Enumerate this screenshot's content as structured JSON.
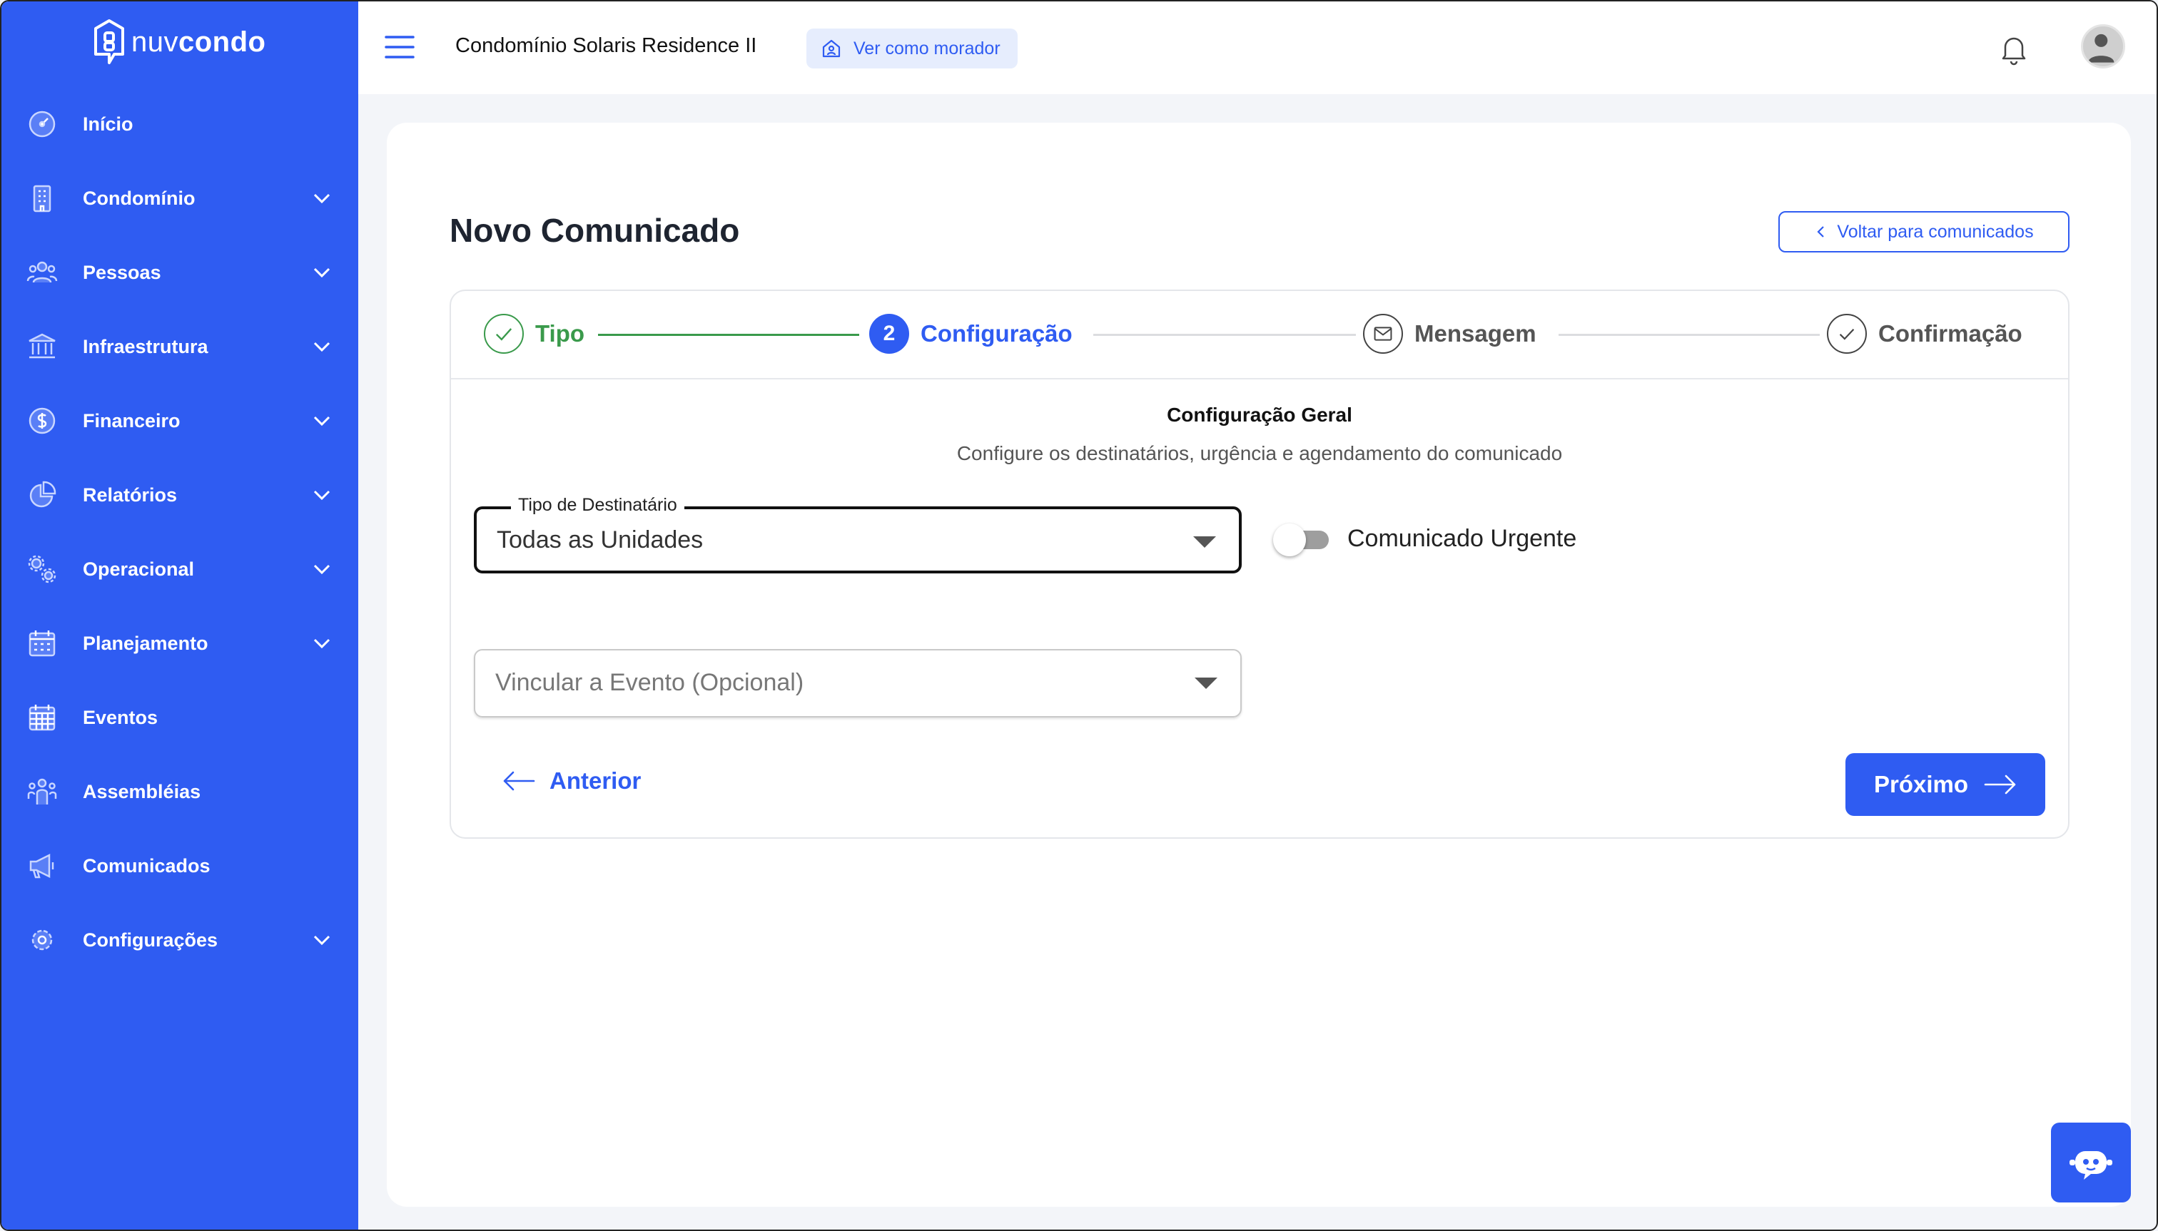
{
  "brand": {
    "name_light": "nuv",
    "name_bold": "condo",
    "accent": "#2f5cf2",
    "success": "#3a9a4b"
  },
  "sidebar": {
    "items": [
      {
        "label": "Início",
        "icon": "dashboard-icon",
        "expandable": false
      },
      {
        "label": "Condomínio",
        "icon": "building-icon",
        "expandable": true
      },
      {
        "label": "Pessoas",
        "icon": "people-icon",
        "expandable": true
      },
      {
        "label": "Infraestrutura",
        "icon": "bank-icon",
        "expandable": true
      },
      {
        "label": "Financeiro",
        "icon": "dollar-icon",
        "expandable": true
      },
      {
        "label": "Relatórios",
        "icon": "pie-chart-icon",
        "expandable": true
      },
      {
        "label": "Operacional",
        "icon": "gears-icon",
        "expandable": true
      },
      {
        "label": "Planejamento",
        "icon": "calendar-icon",
        "expandable": true
      },
      {
        "label": "Eventos",
        "icon": "calendar-grid-icon",
        "expandable": false
      },
      {
        "label": "Assembléias",
        "icon": "assembly-icon",
        "expandable": false
      },
      {
        "label": "Comunicados",
        "icon": "megaphone-icon",
        "expandable": false
      },
      {
        "label": "Configurações",
        "icon": "gear-icon",
        "expandable": true
      }
    ]
  },
  "topbar": {
    "condo_name": "Condomínio Solaris Residence II",
    "view_as_resident": "Ver como morador"
  },
  "page": {
    "title": "Novo Comunicado",
    "back_button": "Voltar para comunicados"
  },
  "stepper": {
    "steps": [
      {
        "label": "Tipo",
        "state": "completed"
      },
      {
        "label": "Configuração",
        "state": "active",
        "number": "2"
      },
      {
        "label": "Mensagem",
        "state": "pending"
      },
      {
        "label": "Confirmação",
        "state": "pending"
      }
    ]
  },
  "form": {
    "section_title": "Configuração Geral",
    "section_subtitle": "Configure os destinatários, urgência e agendamento do comunicado",
    "recipient_type": {
      "label": "Tipo de Destinatário",
      "value": "Todas as Unidades"
    },
    "urgent_toggle": {
      "label": "Comunicado Urgente",
      "checked": false
    },
    "event_link": {
      "placeholder": "Vincular a Evento (Opcional)"
    },
    "prev_button": "Anterior",
    "next_button": "Próximo"
  }
}
